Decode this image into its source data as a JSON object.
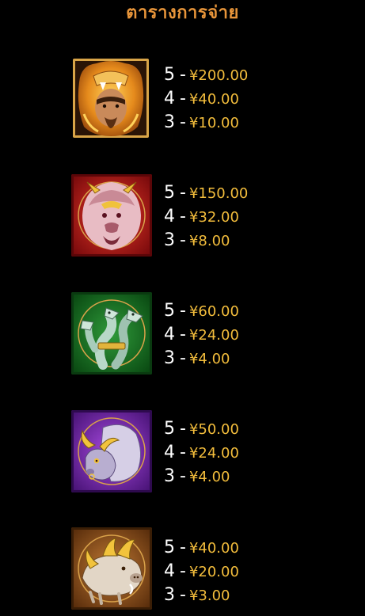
{
  "header": {
    "title": "ตารางการจ่าย"
  },
  "colors": {
    "title": "#e8953a",
    "count_text": "#ffffff",
    "amount_text": "#f3bd3c",
    "background": "#000000"
  },
  "paytable": [
    {
      "symbol": "hercules-lion-helmet-icon",
      "frame_color": "#b8863a",
      "pays": [
        {
          "count": "5",
          "amount": "¥200.00"
        },
        {
          "count": "4",
          "amount": "¥40.00"
        },
        {
          "count": "3",
          "amount": "¥10.00"
        }
      ]
    },
    {
      "symbol": "nemean-lion-icon",
      "frame_color": "#c4151c",
      "pays": [
        {
          "count": "5",
          "amount": "¥150.00"
        },
        {
          "count": "4",
          "amount": "¥32.00"
        },
        {
          "count": "3",
          "amount": "¥8.00"
        }
      ]
    },
    {
      "symbol": "hydra-icon",
      "frame_color": "#2e8a22",
      "pays": [
        {
          "count": "5",
          "amount": "¥60.00"
        },
        {
          "count": "4",
          "amount": "¥24.00"
        },
        {
          "count": "3",
          "amount": "¥4.00"
        }
      ]
    },
    {
      "symbol": "cretan-bull-icon",
      "frame_color": "#8a3bc4",
      "pays": [
        {
          "count": "5",
          "amount": "¥50.00"
        },
        {
          "count": "4",
          "amount": "¥24.00"
        },
        {
          "count": "3",
          "amount": "¥4.00"
        }
      ]
    },
    {
      "symbol": "erymanthian-boar-icon",
      "frame_color": "#a8652a",
      "pays": [
        {
          "count": "5",
          "amount": "¥40.00"
        },
        {
          "count": "4",
          "amount": "¥20.00"
        },
        {
          "count": "3",
          "amount": "¥3.00"
        }
      ]
    }
  ]
}
